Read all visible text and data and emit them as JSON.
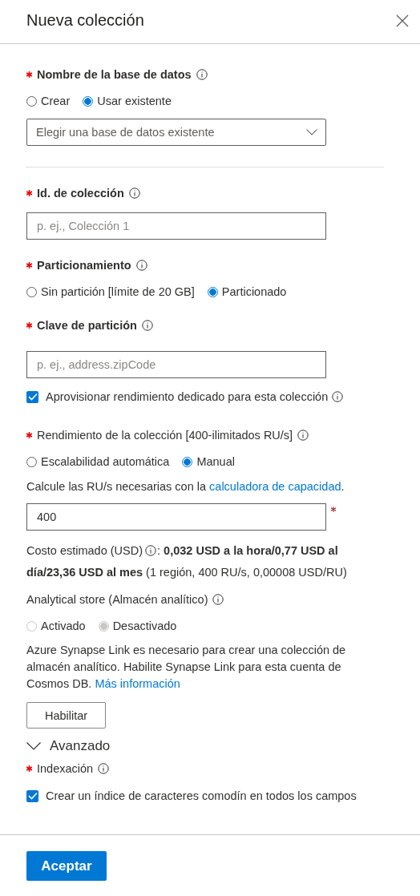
{
  "panel": {
    "title": "Nueva colección"
  },
  "database": {
    "label": "Nombre de la base de datos",
    "required": true,
    "options": [
      {
        "label": "Crear",
        "selected": false
      },
      {
        "label": "Usar existente",
        "selected": true
      }
    ],
    "dropdown": {
      "placeholder": "Elegir una base de datos existente"
    }
  },
  "collection_id": {
    "label": "Id. de colección",
    "required": true,
    "placeholder": "p. ej., Colección 1"
  },
  "partitioning": {
    "label": "Particionamiento",
    "required": true,
    "options": [
      {
        "label": "Sin partición [límite de 20 GB]",
        "selected": false
      },
      {
        "label": "Particionado",
        "selected": true
      }
    ]
  },
  "partition_key": {
    "label": "Clave de partición",
    "required": true,
    "placeholder": "p. ej., address.zipCode"
  },
  "dedicated_throughput": {
    "label": "Aprovisionar rendimiento dedicado para esta colección",
    "checked": true
  },
  "throughput": {
    "label": "Rendimiento de la colección [400-ilimitados RU/s]",
    "required": true,
    "options": [
      {
        "label": "Escalabilidad automática",
        "selected": false
      },
      {
        "label": "Manual",
        "selected": true
      }
    ],
    "hint": "Calcule las RU/s necesarias con la",
    "hint_link": "calculadora de capacidad",
    "hint_end": ".",
    "value": "400",
    "value_required": true,
    "cost_label": "Costo estimado (USD)",
    "cost_text": ": **0,032 USD a la hora/0,77 USD al día/23,36 USD al mes** (1 región, 400 RU/s, 0,00008 USD/RU)"
  },
  "analytical_store": {
    "label": "Analytical store (Almacén analítico)",
    "options": [
      {
        "label": "Activado",
        "selected": false,
        "disabled": true
      },
      {
        "label": "Desactivado",
        "selected": true,
        "disabled": true
      }
    ],
    "note": "Azure Synapse Link es necesario para crear una colección de almacén analítico. Habilite Synapse Link para esta cuenta de Cosmos DB.",
    "note_link": "Más información",
    "button": "Habilitar"
  },
  "advanced": {
    "label": "Avanzado",
    "expanded": true
  },
  "indexing": {
    "label": "Indexación",
    "required": true,
    "checkbox": {
      "label": "Crear un índice de caracteres comodín en todos los campos",
      "checked": true
    }
  },
  "footer": {
    "button": "Aceptar"
  }
}
